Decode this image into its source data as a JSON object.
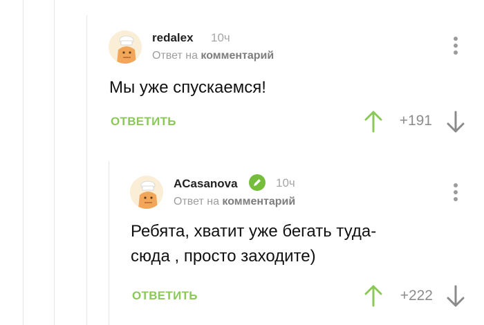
{
  "comments": [
    {
      "author": "redalex",
      "time": "10ч",
      "reply_prefix": "Ответ на",
      "reply_target": "комментарий",
      "text": "Мы уже спускаемся!",
      "reply_label": "ОТВЕТИТЬ",
      "rating": "+191"
    },
    {
      "author": "ACasanova",
      "time": "10ч",
      "reply_prefix": "Ответ на",
      "reply_target": "комментарий",
      "text_line1": "Ребята, хватит уже бегать туда-",
      "text_line2": "сюда , просто заходите)",
      "reply_label": "ОТВЕТИТЬ",
      "rating": "+222",
      "verified_icon": "pencil-icon"
    }
  ],
  "colors": {
    "accent_green": "#8ac858",
    "verified_green": "#76bd3c",
    "muted_gray": "#9d9d9d"
  }
}
